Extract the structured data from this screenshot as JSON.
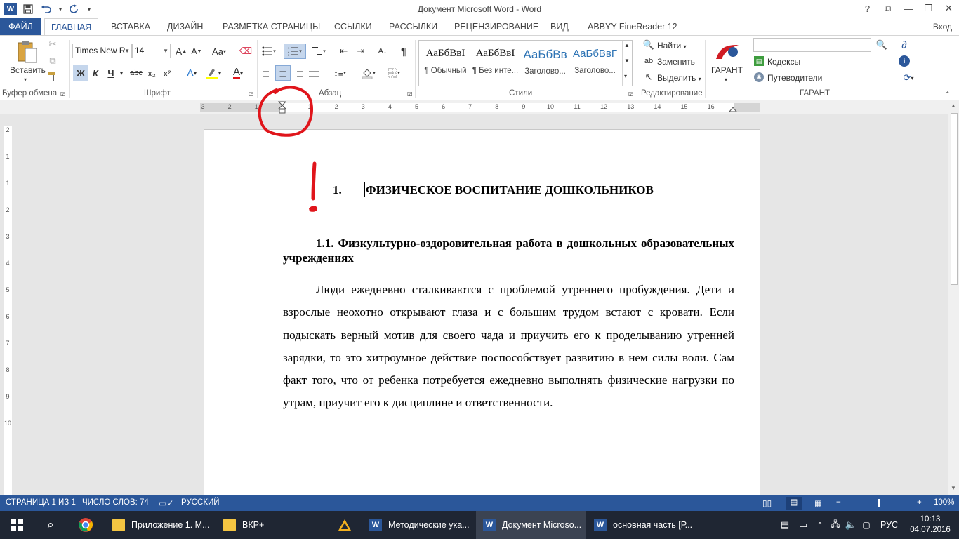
{
  "title_bar": {
    "title": "Документ Microsoft Word - Word",
    "app_logo": "W",
    "help": "?",
    "controls": {
      "ribbon_display": "⧉",
      "minimize": "—",
      "restore": "❐",
      "close": "✕"
    }
  },
  "quick_access": {
    "save_icon": "save-icon",
    "undo_icon": "undo-icon",
    "redo_icon": "redo-icon"
  },
  "tabs": [
    {
      "label": "ФАЙЛ"
    },
    {
      "label": "ГЛАВНАЯ"
    },
    {
      "label": "ВСТАВКА"
    },
    {
      "label": "ДИЗАЙН"
    },
    {
      "label": "РАЗМЕТКА СТРАНИЦЫ"
    },
    {
      "label": "ССЫЛКИ"
    },
    {
      "label": "РАССЫЛКИ"
    },
    {
      "label": "РЕЦЕНЗИРОВАНИЕ"
    },
    {
      "label": "ВИД"
    },
    {
      "label": "ABBYY FineReader 12"
    }
  ],
  "signin": "Вход",
  "ribbon": {
    "clipboard": {
      "paste_label": "Вставить",
      "group_label": "Буфер обмена"
    },
    "font": {
      "font_name": "Times New R",
      "font_size": "14",
      "group_label": "Шрифт",
      "bold": "Ж",
      "italic": "К",
      "underline": "Ч",
      "strike": "abc",
      "subscript": "x₂",
      "superscript": "x²",
      "grow": "A",
      "shrink": "A",
      "case": "Aa"
    },
    "paragraph": {
      "group_label": "Абзац",
      "pilcrow": "¶"
    },
    "styles": {
      "group_label": "Стили",
      "items": [
        {
          "preview": "АаБбВвІ",
          "label": "¶ Обычный"
        },
        {
          "preview": "АаБбВвІ",
          "label": "¶ Без инте..."
        },
        {
          "preview": "АаБбВв",
          "label": "Заголово..."
        },
        {
          "preview": "АаБбВвГ",
          "label": "Заголово..."
        }
      ]
    },
    "editing": {
      "find": "Найти",
      "replace": "Заменить",
      "select": "Выделить",
      "group_label": "Редактирование"
    },
    "garant": {
      "label": "ГАРАНТ",
      "codes": "Кодексы",
      "guides": "Путеводители",
      "group_label": "ГАРАНТ"
    }
  },
  "ruler": {
    "h_numbers": [
      "3",
      "2",
      "1",
      "1",
      "2",
      "3",
      "4",
      "5",
      "6",
      "7",
      "8",
      "9",
      "10",
      "11",
      "12",
      "13",
      "14",
      "15",
      "16"
    ],
    "v_numbers": [
      "2",
      "1",
      "1",
      "2",
      "3",
      "4",
      "5",
      "6",
      "7",
      "8",
      "9",
      "10"
    ]
  },
  "document": {
    "heading1_num": "1.",
    "heading1_text": "ФИЗИЧЕСКОЕ ВОСПИТАНИЕ ДОШКОЛЬНИКОВ",
    "heading2": "1.1. Физкультурно-оздоровительная работа в дошкольных образовательных учреждениях",
    "body": "Люди ежедневно сталкиваются с проблемой утреннего пробуждения. Дети и взрослые неохотно открывают глаза и с большим трудом встают с кровати. Если подыскать верный мотив для своего чада и приучить его к проделыванию утренней зарядки, то это хитроумное действие поспособствует развитию в нем силы воли. Сам факт того, что от ребенка потребуется ежедневно выполнять физические нагрузки по утрам, приучит его к дисциплине и ответственности."
  },
  "status_bar": {
    "page": "СТРАНИЦА 1 ИЗ 1",
    "words": "ЧИСЛО СЛОВ: 74",
    "language": "РУССКИЙ",
    "zoom": "100%",
    "zoom_minus": "−",
    "zoom_plus": "+"
  },
  "taskbar": {
    "items": [
      {
        "label": "Приложение 1. М..."
      },
      {
        "label": "ВКР+"
      },
      {
        "label": "Методические ука..."
      },
      {
        "label": "Документ Microso..."
      },
      {
        "label": "основная часть [Р..."
      }
    ],
    "lang": "РУС",
    "time": "10:13",
    "date": "04.07.2016"
  },
  "colors": {
    "accent": "#2b579a",
    "taskbar": "#1f2633",
    "annotation": "#e0151b"
  }
}
